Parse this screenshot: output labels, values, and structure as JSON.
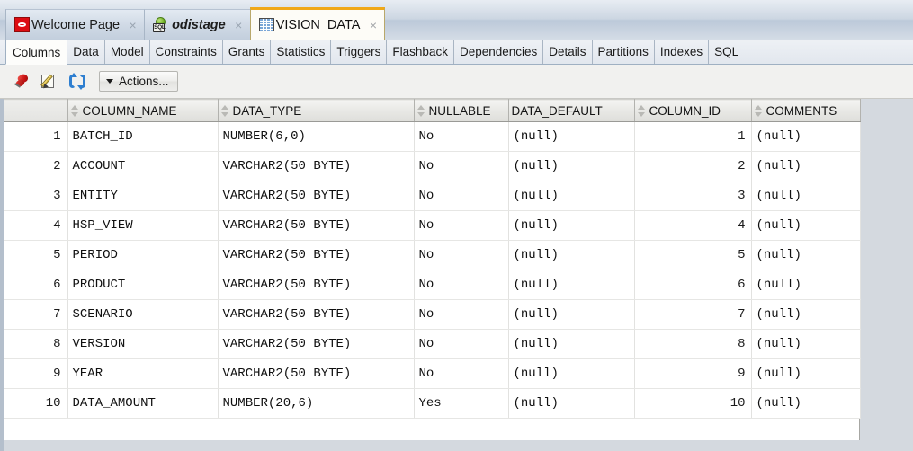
{
  "window": {
    "tabs": [
      {
        "label": "Welcome Page",
        "icon": "oracle-logo-icon",
        "active": false,
        "italic": false,
        "close": "×"
      },
      {
        "label": "odistage",
        "icon": "sql-connection-icon",
        "active": false,
        "italic": true,
        "close": "×"
      },
      {
        "label": "VISION_DATA",
        "icon": "table-grid-icon",
        "active": true,
        "italic": false,
        "close": "×"
      }
    ]
  },
  "subtabs": [
    {
      "label": "Columns",
      "active": true
    },
    {
      "label": "Data",
      "active": false
    },
    {
      "label": "Model",
      "active": false
    },
    {
      "label": "Constraints",
      "active": false
    },
    {
      "label": "Grants",
      "active": false
    },
    {
      "label": "Statistics",
      "active": false
    },
    {
      "label": "Triggers",
      "active": false
    },
    {
      "label": "Flashback",
      "active": false
    },
    {
      "label": "Dependencies",
      "active": false
    },
    {
      "label": "Details",
      "active": false
    },
    {
      "label": "Partitions",
      "active": false
    },
    {
      "label": "Indexes",
      "active": false
    },
    {
      "label": "SQL",
      "active": false
    }
  ],
  "toolbar": {
    "pin_icon": "pin-icon",
    "edit_icon": "edit-icon",
    "refresh_icon": "refresh-icon",
    "actions_label": "Actions..."
  },
  "grid": {
    "columns": [
      {
        "key": "rownum",
        "label": "",
        "sortable": false,
        "align": "right"
      },
      {
        "key": "COLUMN_NAME",
        "label": "COLUMN_NAME",
        "sortable": true,
        "align": "left"
      },
      {
        "key": "DATA_TYPE",
        "label": "DATA_TYPE",
        "sortable": true,
        "align": "left"
      },
      {
        "key": "NULLABLE",
        "label": "NULLABLE",
        "sortable": true,
        "align": "left"
      },
      {
        "key": "DATA_DEFAULT",
        "label": "DATA_DEFAULT",
        "sortable": false,
        "align": "left"
      },
      {
        "key": "COLUMN_ID",
        "label": "COLUMN_ID",
        "sortable": true,
        "align": "right"
      },
      {
        "key": "COMMENTS",
        "label": "COMMENTS",
        "sortable": true,
        "align": "left"
      }
    ],
    "rows": [
      {
        "rownum": "1",
        "COLUMN_NAME": "BATCH_ID",
        "DATA_TYPE": "NUMBER(6,0)",
        "NULLABLE": "No",
        "DATA_DEFAULT": "(null)",
        "COLUMN_ID": "1",
        "COMMENTS": "(null)"
      },
      {
        "rownum": "2",
        "COLUMN_NAME": "ACCOUNT",
        "DATA_TYPE": "VARCHAR2(50 BYTE)",
        "NULLABLE": "No",
        "DATA_DEFAULT": "(null)",
        "COLUMN_ID": "2",
        "COMMENTS": "(null)"
      },
      {
        "rownum": "3",
        "COLUMN_NAME": "ENTITY",
        "DATA_TYPE": "VARCHAR2(50 BYTE)",
        "NULLABLE": "No",
        "DATA_DEFAULT": "(null)",
        "COLUMN_ID": "3",
        "COMMENTS": "(null)"
      },
      {
        "rownum": "4",
        "COLUMN_NAME": "HSP_VIEW",
        "DATA_TYPE": "VARCHAR2(50 BYTE)",
        "NULLABLE": "No",
        "DATA_DEFAULT": "(null)",
        "COLUMN_ID": "4",
        "COMMENTS": "(null)"
      },
      {
        "rownum": "5",
        "COLUMN_NAME": "PERIOD",
        "DATA_TYPE": "VARCHAR2(50 BYTE)",
        "NULLABLE": "No",
        "DATA_DEFAULT": "(null)",
        "COLUMN_ID": "5",
        "COMMENTS": "(null)"
      },
      {
        "rownum": "6",
        "COLUMN_NAME": "PRODUCT",
        "DATA_TYPE": "VARCHAR2(50 BYTE)",
        "NULLABLE": "No",
        "DATA_DEFAULT": "(null)",
        "COLUMN_ID": "6",
        "COMMENTS": "(null)"
      },
      {
        "rownum": "7",
        "COLUMN_NAME": "SCENARIO",
        "DATA_TYPE": "VARCHAR2(50 BYTE)",
        "NULLABLE": "No",
        "DATA_DEFAULT": "(null)",
        "COLUMN_ID": "7",
        "COMMENTS": "(null)"
      },
      {
        "rownum": "8",
        "COLUMN_NAME": "VERSION",
        "DATA_TYPE": "VARCHAR2(50 BYTE)",
        "NULLABLE": "No",
        "DATA_DEFAULT": "(null)",
        "COLUMN_ID": "8",
        "COMMENTS": "(null)"
      },
      {
        "rownum": "9",
        "COLUMN_NAME": "YEAR",
        "DATA_TYPE": "VARCHAR2(50 BYTE)",
        "NULLABLE": "No",
        "DATA_DEFAULT": "(null)",
        "COLUMN_ID": "9",
        "COMMENTS": "(null)"
      },
      {
        "rownum": "10",
        "COLUMN_NAME": "DATA_AMOUNT",
        "DATA_TYPE": "NUMBER(20,6)",
        "NULLABLE": "Yes",
        "DATA_DEFAULT": "(null)",
        "COLUMN_ID": "10",
        "COMMENTS": "(null)"
      }
    ]
  },
  "colors": {
    "active_tab_accent": "#f0a818",
    "chrome": "#ccd6e2",
    "grid_bg": "#ffffff",
    "header_bg": "#e9e9e6",
    "oracle_red": "#dd0c12",
    "refresh_blue": "#2f7fd0"
  }
}
